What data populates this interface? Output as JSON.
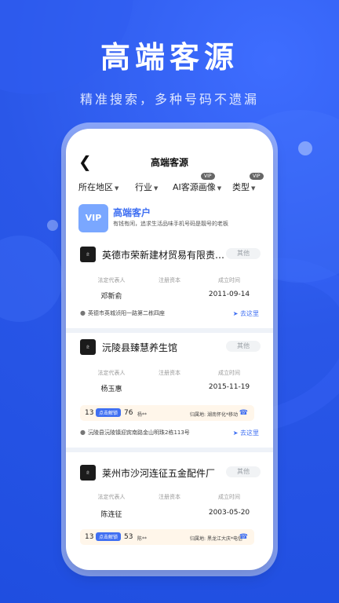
{
  "hero": {
    "title": "高端客源",
    "subtitle": "精准搜索，多种号码不遗漏"
  },
  "app": {
    "nav_title": "高端客源",
    "back_icon": "chevron-left-icon",
    "filters": [
      {
        "label": "所在地区"
      },
      {
        "label": "行业"
      },
      {
        "label": "AI客源画像",
        "badge": "VIP"
      },
      {
        "label": "类型",
        "badge": "VIP"
      }
    ],
    "vip_banner": {
      "badge": "VIP",
      "title": "高端客户",
      "desc": "有钱有闲，追求生活品味手机号码是靓号的老板"
    },
    "labels": {
      "legal_rep": "法定代表人",
      "capital": "注册资本",
      "founded": "成立时间",
      "goto": "去这里",
      "owner_area": "归属地:"
    },
    "companies": [
      {
        "name": "英德市荣新建材贸易有限责任...",
        "tag": "其他",
        "legal_rep": "邓新俞",
        "capital": "",
        "founded": "2011-09-14",
        "address": "英德市英城浈阳一路第二栋四座"
      },
      {
        "name": "沅陵县臻慧养生馆",
        "tag": "其他",
        "legal_rep": "杨玉惠",
        "capital": "",
        "founded": "2015-11-19",
        "phone_prefix": "13",
        "unlock": "点击解锁",
        "phone_suffix": "76",
        "owner": "杨**",
        "area": "湖南怀化*移动",
        "address": "沅陵县沅陵镇迎宾南路金山明珠2栋113号"
      },
      {
        "name": "莱州市沙河连征五金配件厂",
        "tag": "其他",
        "legal_rep": "陈连征",
        "capital": "",
        "founded": "2003-05-20",
        "phone_prefix": "13",
        "unlock": "点击解锁",
        "phone_suffix": "53",
        "owner": "陈**",
        "area": "黑龙江大庆*电信"
      }
    ]
  }
}
